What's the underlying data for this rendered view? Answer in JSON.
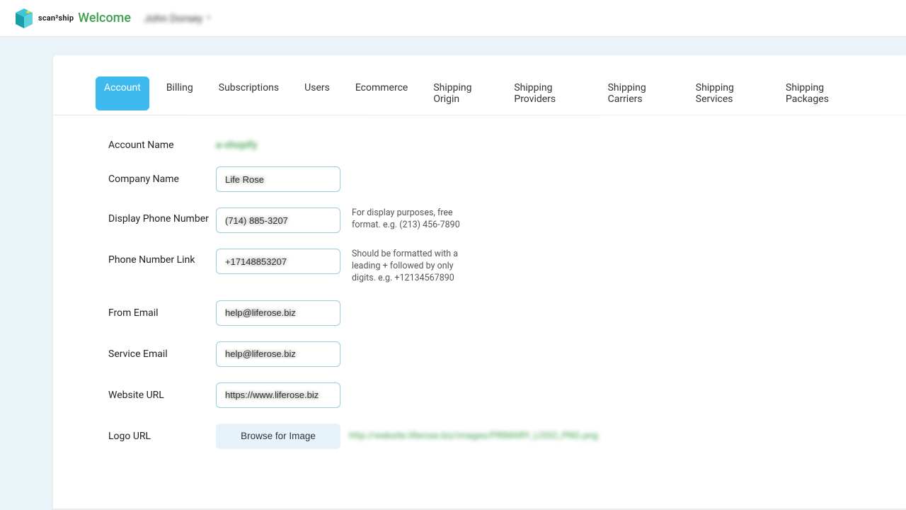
{
  "header": {
    "brand_text": "scan²ship",
    "welcome": "Welcome",
    "username": "John Dorsey",
    "chevron": "▾"
  },
  "tabs": [
    {
      "label": "Account",
      "active": true
    },
    {
      "label": "Billing",
      "active": false
    },
    {
      "label": "Subscriptions",
      "active": false
    },
    {
      "label": "Users",
      "active": false
    },
    {
      "label": "Ecommerce",
      "active": false
    },
    {
      "label": "Shipping Origin",
      "active": false
    },
    {
      "label": "Shipping Providers",
      "active": false
    },
    {
      "label": "Shipping Carriers",
      "active": false
    },
    {
      "label": "Shipping Services",
      "active": false
    },
    {
      "label": "Shipping Packages",
      "active": false
    }
  ],
  "form": {
    "account_name": {
      "label": "Account Name",
      "value": "a-shopify"
    },
    "company_name": {
      "label": "Company Name",
      "value": "Life Rose"
    },
    "display_phone": {
      "label": "Display Phone Number",
      "value": "(714) 885-3207",
      "hint": "For display purposes, free format. e.g. (213) 456-7890"
    },
    "phone_link": {
      "label": "Phone Number Link",
      "value": "+17148853207",
      "hint": "Should be formatted with a leading + followed by only digits. e.g. +12134567890"
    },
    "from_email": {
      "label": "From Email",
      "value": "help@liferose.biz"
    },
    "service_email": {
      "label": "Service Email",
      "value": "help@liferose.biz"
    },
    "website_url": {
      "label": "Website URL",
      "value": "https://www.liferose.biz"
    },
    "logo_url": {
      "label": "Logo URL",
      "button": "Browse for Image",
      "value": "http://website.liferose.biz/images/PRIMARY_LOGO_PNG.png"
    }
  }
}
